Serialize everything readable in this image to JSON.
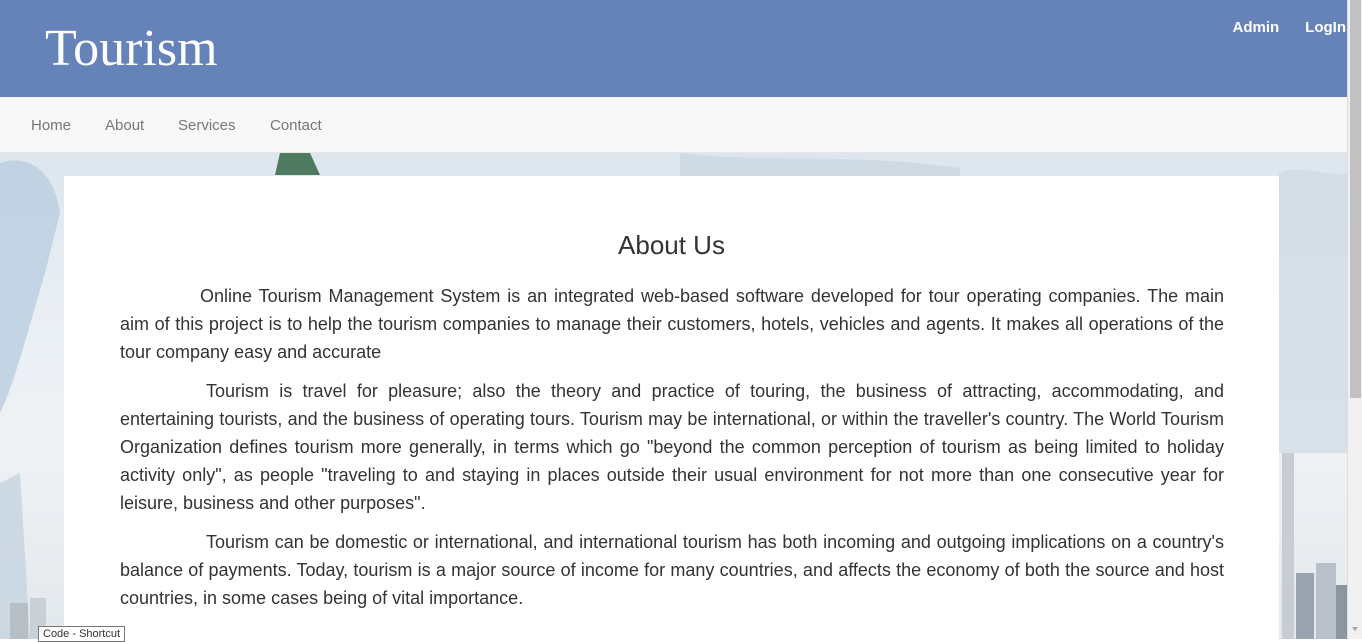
{
  "header": {
    "brand": "Tourism",
    "links": [
      "Admin",
      "LogIn"
    ]
  },
  "nav": {
    "items": [
      "Home",
      "About",
      "Services",
      "Contact"
    ]
  },
  "about": {
    "title": "About Us",
    "paragraphs": [
      "Online Tourism Management System is an integrated web-based software developed for tour operating companies. The main aim of this project is to help the tourism companies to manage their customers, hotels, vehicles and agents. It makes all operations of the tour company easy and accurate",
      "Tourism is travel for pleasure; also the theory and practice of touring, the business of attracting, accommodating, and entertaining tourists, and the business of operating tours. Tourism may be international, or within the traveller's country. The World Tourism Organization defines tourism more generally, in terms which go \"beyond the common perception of tourism as being limited to holiday activity only\", as people \"traveling to and staying in places outside their usual environment for not more than one consecutive year for leisure, business and other purposes\".",
      "Tourism can be domestic or international, and international tourism has both incoming and outgoing implications on a country's balance of payments. Today, tourism is a major source of income for many countries, and affects the economy of both the source and host countries, in some cases being of vital importance."
    ]
  },
  "tooltip": "Code - Shortcut",
  "colors": {
    "header_bg": "#6583b8",
    "nav_bg": "#f8f8f8"
  }
}
